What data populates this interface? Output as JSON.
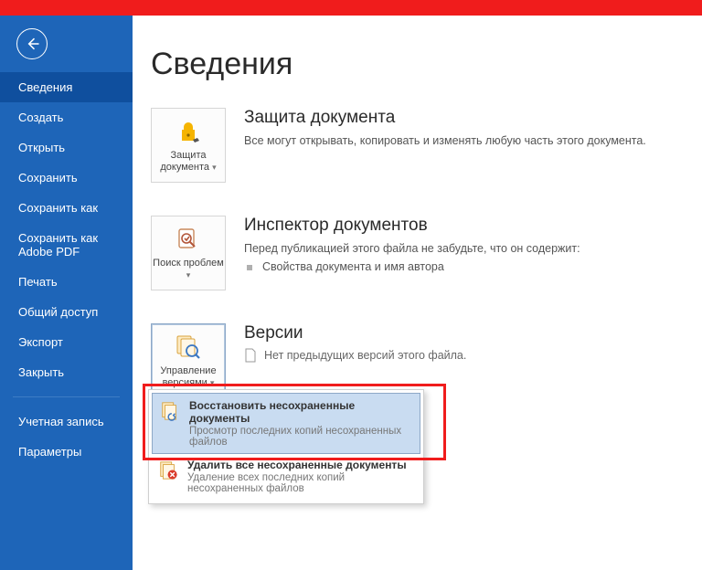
{
  "sidebar": {
    "items": [
      "Сведения",
      "Создать",
      "Открыть",
      "Сохранить",
      "Сохранить как",
      "Сохранить как Adobe PDF",
      "Печать",
      "Общий доступ",
      "Экспорт",
      "Закрыть"
    ],
    "bottom": [
      "Учетная запись",
      "Параметры"
    ]
  },
  "page": {
    "title": "Сведения"
  },
  "sections": {
    "protect": {
      "tile": "Защита документа",
      "heading": "Защита документа",
      "text": "Все могут открывать, копировать и изменять любую часть этого документа."
    },
    "inspect": {
      "tile": "Поиск проблем",
      "heading": "Инспектор документов",
      "text": "Перед публикацией этого файла не забудьте, что он содержит:",
      "bullet": "Свойства документа и имя автора"
    },
    "versions": {
      "tile": "Управление версиями",
      "heading": "Версии",
      "text": "Нет предыдущих версий этого файла."
    }
  },
  "dropdown": {
    "recover": {
      "title": "Восстановить несохраненные документы",
      "sub": "Просмотр последних копий несохраненных файлов"
    },
    "delete": {
      "title": "Удалить все несохраненные документы",
      "sub": "Удаление всех последних копий несохраненных файлов"
    }
  }
}
